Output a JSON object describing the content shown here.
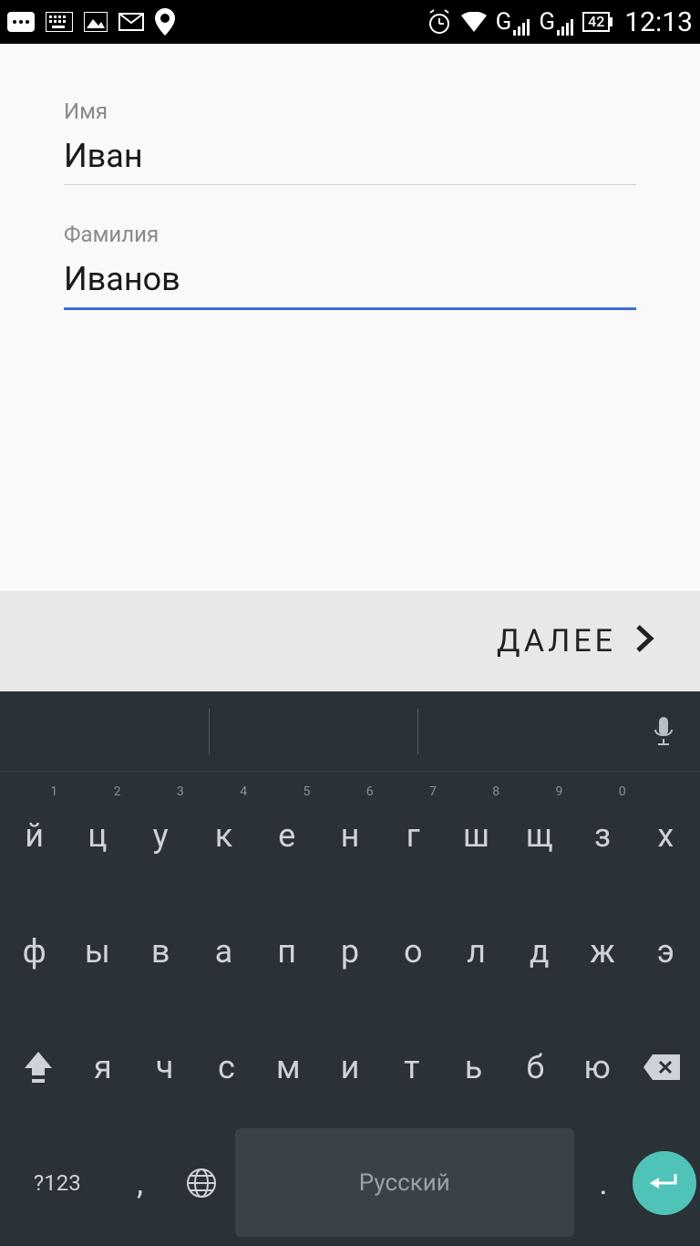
{
  "status": {
    "battery": "42",
    "time": "12:13",
    "network1": "G",
    "network2": "G"
  },
  "form": {
    "first_name_label": "Имя",
    "first_name_value": "Иван",
    "last_name_label": "Фамилия",
    "last_name_value": "Иванов"
  },
  "next_button": "ДАЛЕЕ",
  "keyboard": {
    "row1": [
      {
        "k": "й",
        "n": "1"
      },
      {
        "k": "ц",
        "n": "2"
      },
      {
        "k": "у",
        "n": "3"
      },
      {
        "k": "к",
        "n": "4"
      },
      {
        "k": "е",
        "n": "5"
      },
      {
        "k": "н",
        "n": "6"
      },
      {
        "k": "г",
        "n": "7"
      },
      {
        "k": "ш",
        "n": "8"
      },
      {
        "k": "щ",
        "n": "9"
      },
      {
        "k": "з",
        "n": "0"
      },
      {
        "k": "х",
        "n": ""
      }
    ],
    "row2": [
      "ф",
      "ы",
      "в",
      "а",
      "п",
      "р",
      "о",
      "л",
      "д",
      "ж",
      "э"
    ],
    "row3": [
      "я",
      "ч",
      "с",
      "м",
      "и",
      "т",
      "ь",
      "б",
      "ю"
    ],
    "symbols": "?123",
    "comma": ",",
    "period": ".",
    "space_label": "Русский"
  }
}
